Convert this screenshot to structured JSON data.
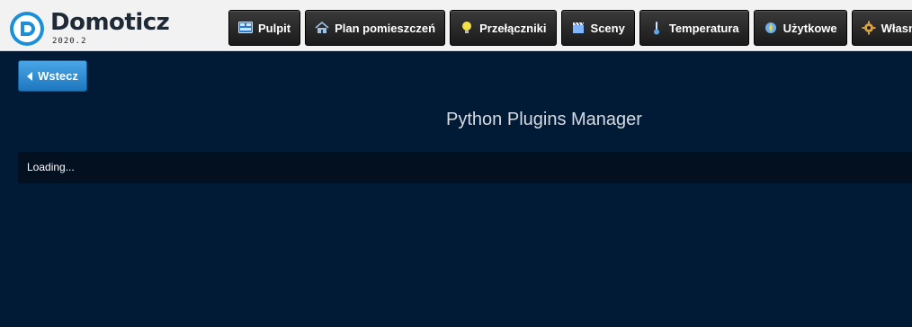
{
  "brand": {
    "name": "Domoticz",
    "version": "2020.2"
  },
  "nav": [
    {
      "label": "Pulpit",
      "icon": "dashboard-icon"
    },
    {
      "label": "Plan pomieszczeń",
      "icon": "house-icon"
    },
    {
      "label": "Przełączniki",
      "icon": "lightbulb-icon"
    },
    {
      "label": "Sceny",
      "icon": "clapperboard-icon"
    },
    {
      "label": "Temperatura",
      "icon": "thermometer-icon"
    },
    {
      "label": "Użytkowe",
      "icon": "utility-icon"
    },
    {
      "label": "Własne",
      "icon": "gear-icon"
    }
  ],
  "back_button": {
    "label": "Wstecz"
  },
  "page": {
    "title": "Python Plugins Manager",
    "status": "Loading..."
  },
  "colors": {
    "background": "#011a36",
    "panel": "#021020",
    "accent": "#2b8ad6"
  }
}
